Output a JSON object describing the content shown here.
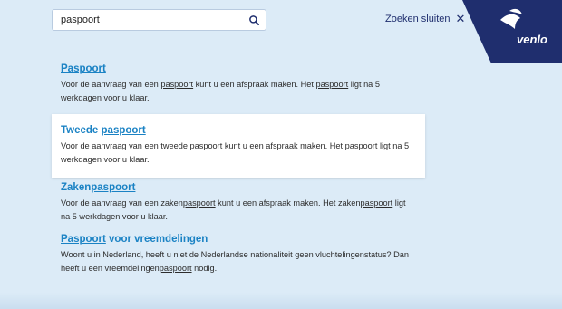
{
  "search": {
    "value": "paspoort"
  },
  "close_search": {
    "label": "Zoeken sluiten",
    "icon": "close-icon"
  },
  "logo": {
    "text": "venlo",
    "color": "#1f2e6e"
  },
  "colors": {
    "background": "#dcebf7",
    "link": "#1a82c4",
    "brand": "#1f2e6e"
  },
  "results": [
    {
      "title_parts": [
        {
          "text": "Paspoort",
          "highlight": true
        }
      ],
      "desc_parts": [
        {
          "text": "Voor de aanvraag van een "
        },
        {
          "text": "paspoort",
          "u": true
        },
        {
          "text": " kunt u een afspraak maken. Het "
        },
        {
          "text": "paspoort",
          "u": true
        },
        {
          "text": " ligt na 5 werkdagen voor u klaar."
        }
      ]
    },
    {
      "title_parts": [
        {
          "text": "Tweede "
        },
        {
          "text": "paspoort",
          "highlight": true
        }
      ],
      "desc_parts": [
        {
          "text": "Voor de aanvraag van een tweede "
        },
        {
          "text": "paspoort",
          "u": true
        },
        {
          "text": " kunt u een afspraak maken. Het "
        },
        {
          "text": "paspoort",
          "u": true
        },
        {
          "text": " ligt na 5 werkdagen voor u klaar."
        }
      ]
    },
    {
      "title_parts": [
        {
          "text": "Zaken"
        },
        {
          "text": "paspoort",
          "highlight": true
        }
      ],
      "desc_parts": [
        {
          "text": "Voor de aanvraag van een zaken"
        },
        {
          "text": "paspoort",
          "u": true
        },
        {
          "text": " kunt u een afspraak maken. Het zaken"
        },
        {
          "text": "paspoort",
          "u": true
        },
        {
          "text": " ligt na 5 werkdagen voor u klaar."
        }
      ]
    },
    {
      "title_parts": [
        {
          "text": "Paspoort",
          "highlight": true
        },
        {
          "text": " voor vreemdelingen"
        }
      ],
      "desc_parts": [
        {
          "text": "Woont u in Nederland, heeft u niet de Nederlandse nationaliteit geen vluchtelingenstatus? Dan heeft u een vreemdelingen"
        },
        {
          "text": "paspoort",
          "u": true
        },
        {
          "text": " nodig."
        }
      ]
    }
  ]
}
